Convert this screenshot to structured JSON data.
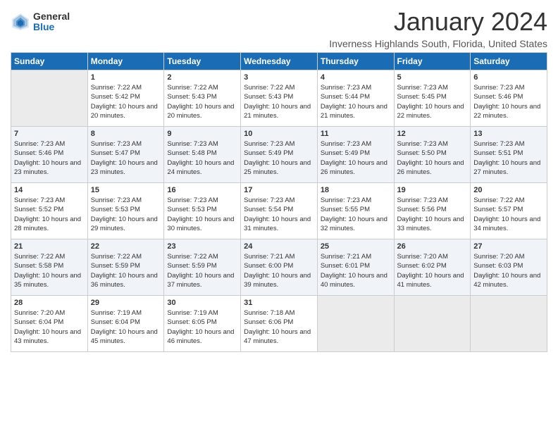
{
  "header": {
    "logo_general": "General",
    "logo_blue": "Blue",
    "title": "January 2024",
    "subtitle": "Inverness Highlands South, Florida, United States"
  },
  "calendar": {
    "days_of_week": [
      "Sunday",
      "Monday",
      "Tuesday",
      "Wednesday",
      "Thursday",
      "Friday",
      "Saturday"
    ],
    "weeks": [
      [
        {
          "day": "",
          "empty": true
        },
        {
          "day": "1",
          "sunrise": "Sunrise: 7:22 AM",
          "sunset": "Sunset: 5:42 PM",
          "daylight": "Daylight: 10 hours and 20 minutes."
        },
        {
          "day": "2",
          "sunrise": "Sunrise: 7:22 AM",
          "sunset": "Sunset: 5:43 PM",
          "daylight": "Daylight: 10 hours and 20 minutes."
        },
        {
          "day": "3",
          "sunrise": "Sunrise: 7:22 AM",
          "sunset": "Sunset: 5:43 PM",
          "daylight": "Daylight: 10 hours and 21 minutes."
        },
        {
          "day": "4",
          "sunrise": "Sunrise: 7:23 AM",
          "sunset": "Sunset: 5:44 PM",
          "daylight": "Daylight: 10 hours and 21 minutes."
        },
        {
          "day": "5",
          "sunrise": "Sunrise: 7:23 AM",
          "sunset": "Sunset: 5:45 PM",
          "daylight": "Daylight: 10 hours and 22 minutes."
        },
        {
          "day": "6",
          "sunrise": "Sunrise: 7:23 AM",
          "sunset": "Sunset: 5:46 PM",
          "daylight": "Daylight: 10 hours and 22 minutes."
        }
      ],
      [
        {
          "day": "7",
          "sunrise": "Sunrise: 7:23 AM",
          "sunset": "Sunset: 5:46 PM",
          "daylight": "Daylight: 10 hours and 23 minutes."
        },
        {
          "day": "8",
          "sunrise": "Sunrise: 7:23 AM",
          "sunset": "Sunset: 5:47 PM",
          "daylight": "Daylight: 10 hours and 23 minutes."
        },
        {
          "day": "9",
          "sunrise": "Sunrise: 7:23 AM",
          "sunset": "Sunset: 5:48 PM",
          "daylight": "Daylight: 10 hours and 24 minutes."
        },
        {
          "day": "10",
          "sunrise": "Sunrise: 7:23 AM",
          "sunset": "Sunset: 5:49 PM",
          "daylight": "Daylight: 10 hours and 25 minutes."
        },
        {
          "day": "11",
          "sunrise": "Sunrise: 7:23 AM",
          "sunset": "Sunset: 5:49 PM",
          "daylight": "Daylight: 10 hours and 26 minutes."
        },
        {
          "day": "12",
          "sunrise": "Sunrise: 7:23 AM",
          "sunset": "Sunset: 5:50 PM",
          "daylight": "Daylight: 10 hours and 26 minutes."
        },
        {
          "day": "13",
          "sunrise": "Sunrise: 7:23 AM",
          "sunset": "Sunset: 5:51 PM",
          "daylight": "Daylight: 10 hours and 27 minutes."
        }
      ],
      [
        {
          "day": "14",
          "sunrise": "Sunrise: 7:23 AM",
          "sunset": "Sunset: 5:52 PM",
          "daylight": "Daylight: 10 hours and 28 minutes."
        },
        {
          "day": "15",
          "sunrise": "Sunrise: 7:23 AM",
          "sunset": "Sunset: 5:53 PM",
          "daylight": "Daylight: 10 hours and 29 minutes."
        },
        {
          "day": "16",
          "sunrise": "Sunrise: 7:23 AM",
          "sunset": "Sunset: 5:53 PM",
          "daylight": "Daylight: 10 hours and 30 minutes."
        },
        {
          "day": "17",
          "sunrise": "Sunrise: 7:23 AM",
          "sunset": "Sunset: 5:54 PM",
          "daylight": "Daylight: 10 hours and 31 minutes."
        },
        {
          "day": "18",
          "sunrise": "Sunrise: 7:23 AM",
          "sunset": "Sunset: 5:55 PM",
          "daylight": "Daylight: 10 hours and 32 minutes."
        },
        {
          "day": "19",
          "sunrise": "Sunrise: 7:23 AM",
          "sunset": "Sunset: 5:56 PM",
          "daylight": "Daylight: 10 hours and 33 minutes."
        },
        {
          "day": "20",
          "sunrise": "Sunrise: 7:22 AM",
          "sunset": "Sunset: 5:57 PM",
          "daylight": "Daylight: 10 hours and 34 minutes."
        }
      ],
      [
        {
          "day": "21",
          "sunrise": "Sunrise: 7:22 AM",
          "sunset": "Sunset: 5:58 PM",
          "daylight": "Daylight: 10 hours and 35 minutes."
        },
        {
          "day": "22",
          "sunrise": "Sunrise: 7:22 AM",
          "sunset": "Sunset: 5:59 PM",
          "daylight": "Daylight: 10 hours and 36 minutes."
        },
        {
          "day": "23",
          "sunrise": "Sunrise: 7:22 AM",
          "sunset": "Sunset: 5:59 PM",
          "daylight": "Daylight: 10 hours and 37 minutes."
        },
        {
          "day": "24",
          "sunrise": "Sunrise: 7:21 AM",
          "sunset": "Sunset: 6:00 PM",
          "daylight": "Daylight: 10 hours and 39 minutes."
        },
        {
          "day": "25",
          "sunrise": "Sunrise: 7:21 AM",
          "sunset": "Sunset: 6:01 PM",
          "daylight": "Daylight: 10 hours and 40 minutes."
        },
        {
          "day": "26",
          "sunrise": "Sunrise: 7:20 AM",
          "sunset": "Sunset: 6:02 PM",
          "daylight": "Daylight: 10 hours and 41 minutes."
        },
        {
          "day": "27",
          "sunrise": "Sunrise: 7:20 AM",
          "sunset": "Sunset: 6:03 PM",
          "daylight": "Daylight: 10 hours and 42 minutes."
        }
      ],
      [
        {
          "day": "28",
          "sunrise": "Sunrise: 7:20 AM",
          "sunset": "Sunset: 6:04 PM",
          "daylight": "Daylight: 10 hours and 43 minutes."
        },
        {
          "day": "29",
          "sunrise": "Sunrise: 7:19 AM",
          "sunset": "Sunset: 6:04 PM",
          "daylight": "Daylight: 10 hours and 45 minutes."
        },
        {
          "day": "30",
          "sunrise": "Sunrise: 7:19 AM",
          "sunset": "Sunset: 6:05 PM",
          "daylight": "Daylight: 10 hours and 46 minutes."
        },
        {
          "day": "31",
          "sunrise": "Sunrise: 7:18 AM",
          "sunset": "Sunset: 6:06 PM",
          "daylight": "Daylight: 10 hours and 47 minutes."
        },
        {
          "day": "",
          "empty": true
        },
        {
          "day": "",
          "empty": true
        },
        {
          "day": "",
          "empty": true
        }
      ]
    ]
  }
}
